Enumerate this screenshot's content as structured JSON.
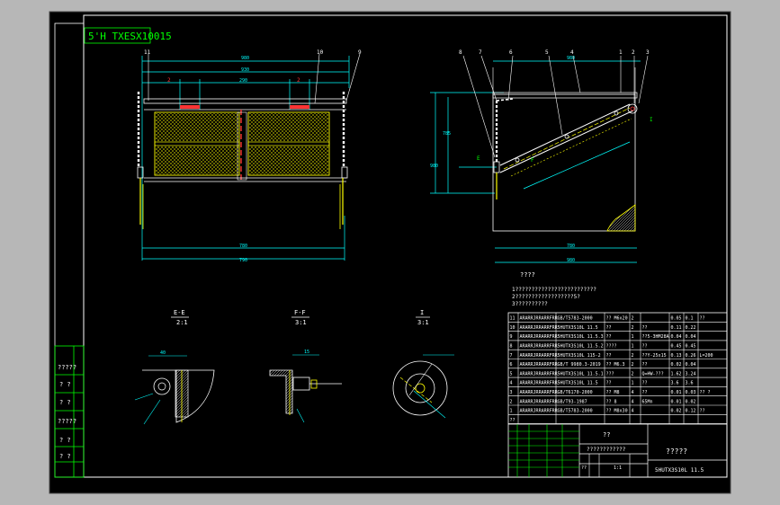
{
  "drawing_code": "5'H TXESX10015",
  "balloons_front": [
    "11",
    "10",
    "9"
  ],
  "balloons_side": [
    "8",
    "7",
    "6",
    "5",
    "4",
    "1",
    "2",
    "3"
  ],
  "section_views": [
    {
      "label": "E-E",
      "scale": "2:1"
    },
    {
      "label": "F-F",
      "scale": "3:1"
    },
    {
      "label": "I",
      "scale": "3:1"
    }
  ],
  "tech_req": {
    "title": "????",
    "lines": [
      "1?????????????????????????",
      "2??????????????????5?",
      "3??????????"
    ]
  },
  "left_margin_labels": [
    "?????",
    "? ?",
    "? ?",
    "?????",
    "? ?",
    "? ?"
  ],
  "bom_rows": [
    [
      "11",
      "ARARRJRRARRFRR",
      "GB/T5783-2000",
      "?? M6x20",
      "2",
      "",
      "0.05",
      "0.1",
      "??"
    ],
    [
      "10",
      "ARARRJRRARRFRR",
      "5HUTX3S10L 11.5",
      "??",
      "2",
      "??",
      "0.11",
      "0.22",
      ""
    ],
    [
      "9",
      "ARARRJRRARRFRR",
      "5HUTX3S10L 11.5.3",
      "??",
      "1",
      "??5-3HM28A",
      "0.04",
      "0.04",
      ""
    ],
    [
      "8",
      "ARARRJRRARRFRR",
      "5HUTX3S10L 11.5.2",
      "????",
      "1",
      "??",
      "0.45",
      "0.45",
      ""
    ],
    [
      "7",
      "ARARRJRRARRFRR",
      "5HUTX3S10L 115-2",
      "??",
      "2",
      "??Y-25x15",
      "0.13",
      "0.26",
      "L=200"
    ],
    [
      "6",
      "ARARRJRRARRFRR",
      "GB/T 9980.3-2019",
      "?? M6.3",
      "2",
      "??",
      "0.02",
      "0.04",
      ""
    ],
    [
      "5",
      "ARARRJRRARRFRR",
      "5HUTX3S10L 11.5.1",
      "???",
      "2",
      "Q=HW-???",
      "1.62",
      "3.24",
      ""
    ],
    [
      "4",
      "ARARRJRRARRFRR",
      "5HUTX3S10L 11.5",
      "??",
      "1",
      "??",
      "3.6",
      "3.6",
      ""
    ],
    [
      "3",
      "ARARRJRRARRFRR",
      "GB/T6170-2000",
      "?? M8",
      "4",
      "??",
      "0.01",
      "0.03",
      "?? ?"
    ],
    [
      "2",
      "ARARRJRRARRFRR",
      "GB/T93-1987",
      "?? 8",
      "4",
      "65Mn",
      "0.01",
      "0.02",
      ""
    ],
    [
      "1",
      "ARARRJRRARRFRR",
      "GB/T5783-2000",
      "?? M8x30",
      "4",
      "",
      "0.02",
      "0.12",
      "??"
    ],
    [
      "??",
      "",
      "",
      "",
      "",
      "",
      "",
      "",
      ""
    ]
  ],
  "title_block": {
    "name": "?????",
    "code": "5HUTX3S10L 11.5",
    "material": "????????????",
    "units": "??",
    "ratios": [
      "1:1"
    ],
    "label": "??"
  }
}
